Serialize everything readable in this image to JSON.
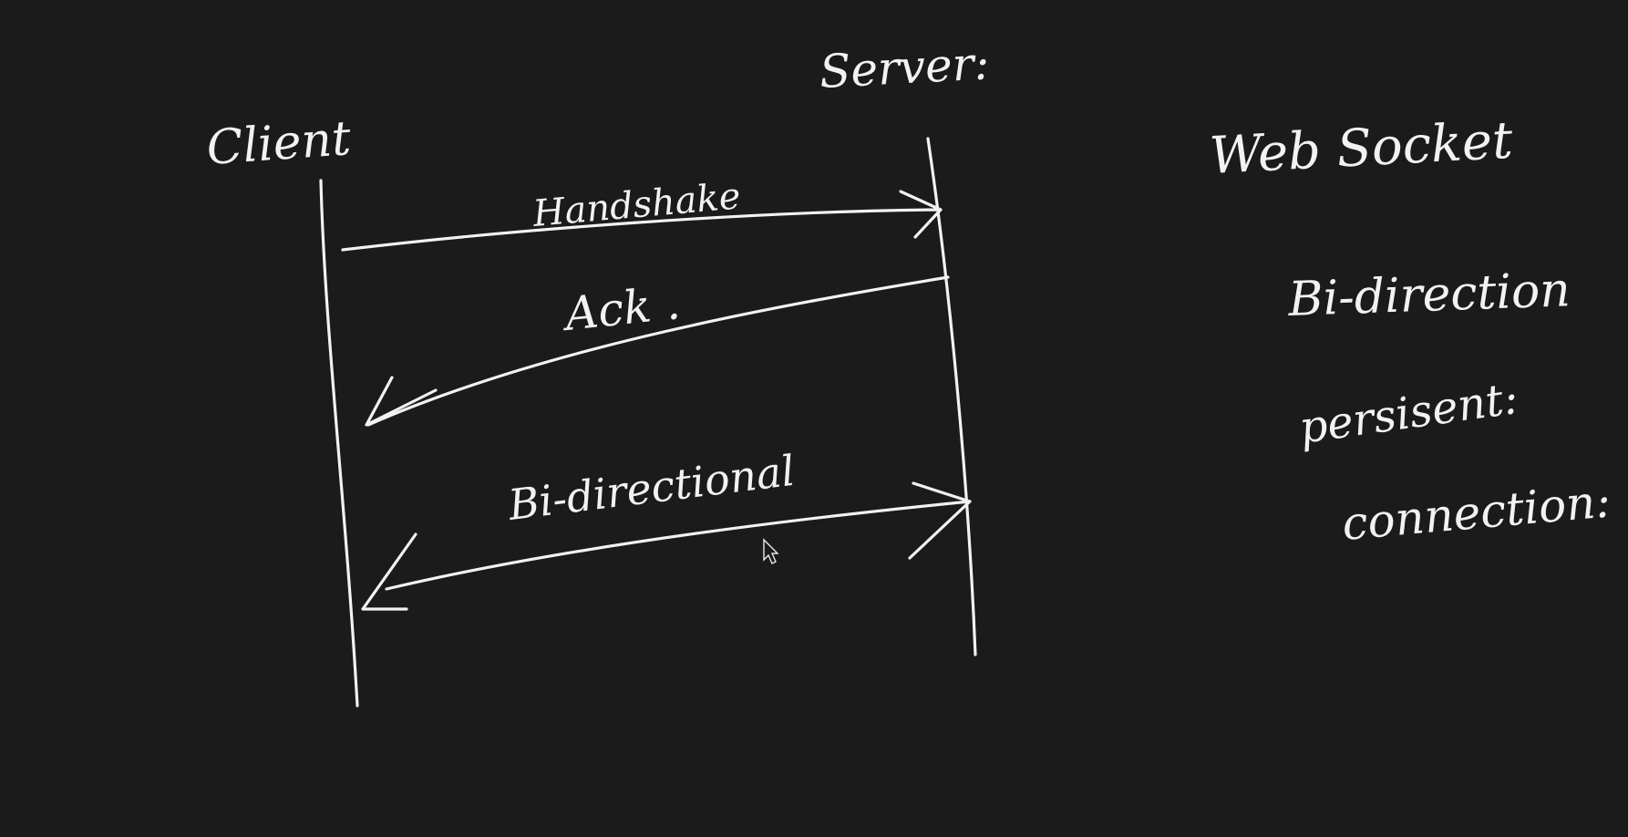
{
  "board": {
    "background": "#1b1b1b",
    "ink": "#f2f2f2"
  },
  "diagram": {
    "participants": {
      "client": "Client",
      "server": "Server:"
    },
    "messages": {
      "handshake": "Handshake",
      "ack": "Ack .",
      "bidirectional": "Bi-directional"
    },
    "notes": {
      "title": "Web Socket",
      "line1": "Bi-direction",
      "line2": "persisent:",
      "line3": "connection:"
    }
  },
  "cursor": {
    "icon": "mouse-pointer-icon"
  }
}
